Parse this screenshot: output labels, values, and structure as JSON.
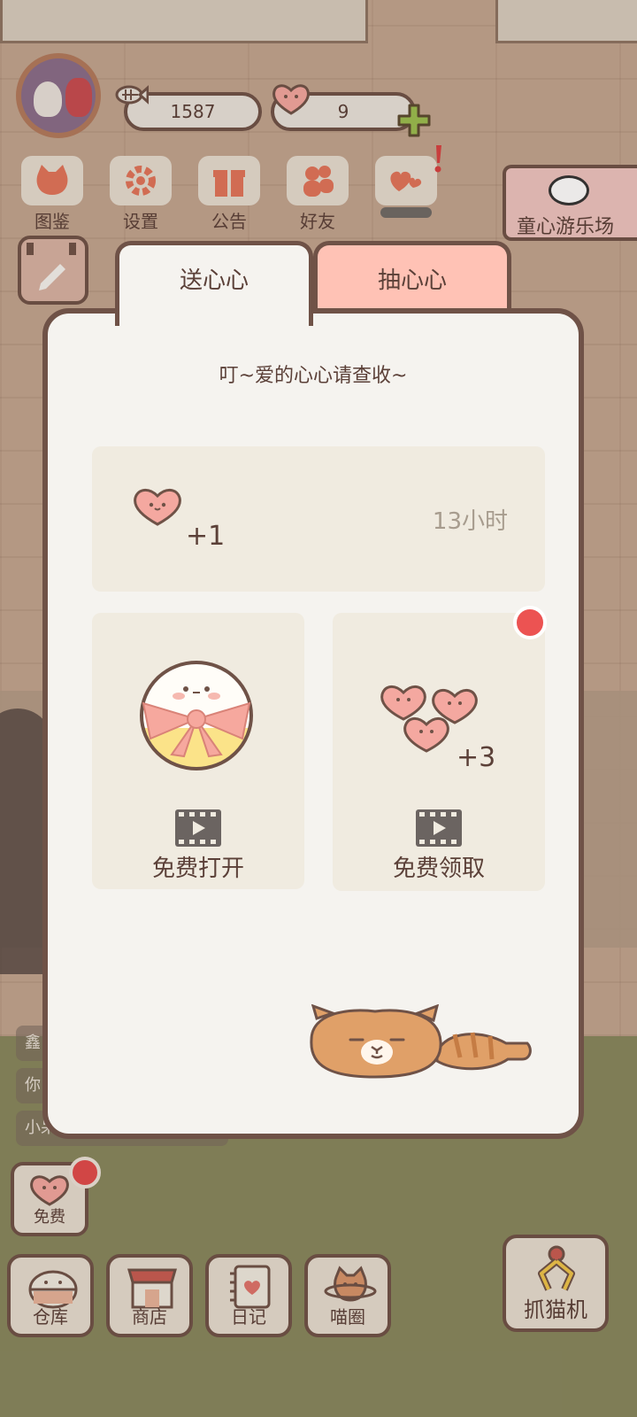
{
  "hud": {
    "fish_count": "1587",
    "heart_count": "9"
  },
  "top_menu": [
    {
      "label": "图鉴",
      "icon": "cat-face-icon"
    },
    {
      "label": "设置",
      "icon": "gear-icon"
    },
    {
      "label": "公告",
      "icon": "gift-icon"
    },
    {
      "label": "好友",
      "icon": "friends-icon"
    },
    {
      "label": "",
      "icon": "hearts-send-icon"
    }
  ],
  "park_banner": {
    "label": "童心游乐场"
  },
  "modal": {
    "tabs": [
      {
        "label": "送心心",
        "active": true
      },
      {
        "label": "抽心心",
        "active": false
      }
    ],
    "title": "叮~爱的心心请查收~",
    "timer_card": {
      "reward": "+1",
      "time": "13小时"
    },
    "gift_card": {
      "label": "免费打开"
    },
    "hearts_card": {
      "reward": "+3",
      "label": "免费领取"
    }
  },
  "bottom": {
    "free_label": "免费",
    "nav": [
      {
        "label": "仓库",
        "icon": "warehouse-icon"
      },
      {
        "label": "商店",
        "icon": "shop-icon"
      },
      {
        "label": "日记",
        "icon": "diary-icon"
      },
      {
        "label": "喵圈",
        "icon": "cat-planet-icon"
      }
    ],
    "claw_label": "抓猫机"
  },
  "background_chat": [
    {
      "text": "鑫"
    },
    {
      "text": "你"
    },
    {
      "text": "小呆"
    }
  ],
  "colors": {
    "outline": "#6f5247",
    "heart_pink": "#f4a8a0",
    "tab_inactive": "#ffc2b5",
    "panel": "#f5f3ef",
    "card": "#f0ebe0",
    "red_dot": "#ec5352"
  }
}
